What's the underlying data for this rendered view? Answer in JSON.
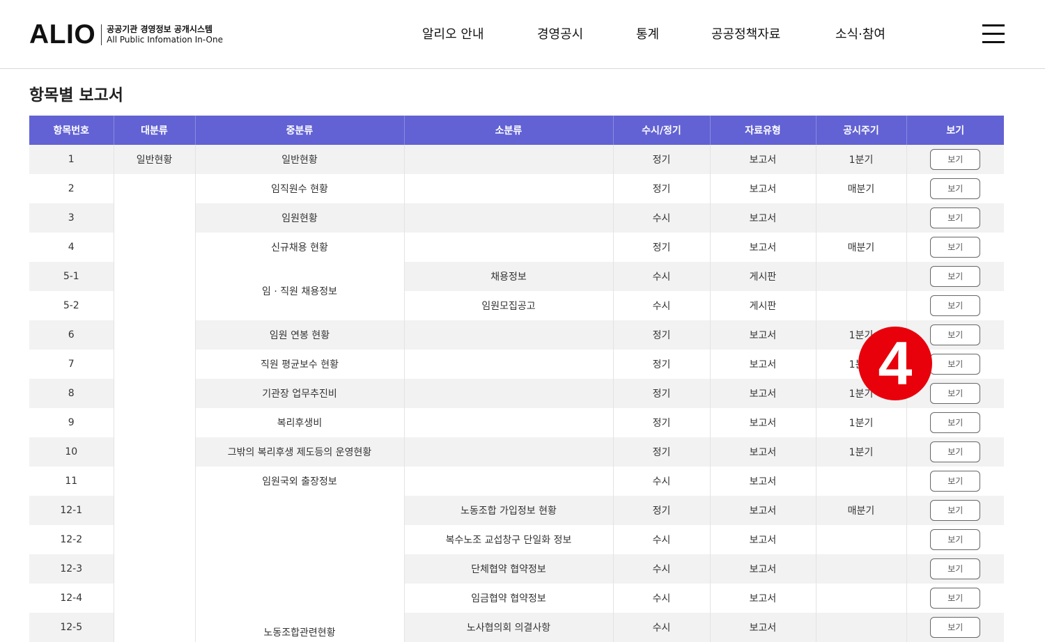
{
  "header": {
    "logo_text": "ALIO",
    "logo_sub_ko": "공공기관 경영정보 공개시스템",
    "logo_sub_en": "All Public Infomation In-One",
    "nav": [
      "알리오 안내",
      "경영공시",
      "통계",
      "공공정책자료",
      "소식·참여"
    ],
    "menu_icon": "hamburger-menu-icon"
  },
  "page": {
    "title": "항목별 보고서"
  },
  "table": {
    "headers": [
      "항목번호",
      "대분류",
      "중분류",
      "소분류",
      "수시/정기",
      "자료유형",
      "공시주기",
      "보기"
    ],
    "view_label": "보기",
    "rows": [
      {
        "no": "1",
        "major": "일반현황",
        "mid": "일반현황",
        "minor": "",
        "type": "정기",
        "data_type": "보고서",
        "cycle": "1분기"
      },
      {
        "no": "2",
        "major": "",
        "mid": "임직원수 현황",
        "minor": "",
        "type": "정기",
        "data_type": "보고서",
        "cycle": "매분기"
      },
      {
        "no": "3",
        "major": "",
        "mid": "임원현황",
        "minor": "",
        "type": "수시",
        "data_type": "보고서",
        "cycle": ""
      },
      {
        "no": "4",
        "major": "",
        "mid": "신규채용 현황",
        "minor": "",
        "type": "정기",
        "data_type": "보고서",
        "cycle": "매분기"
      },
      {
        "no": "5-1",
        "major": "",
        "mid": "임 · 직원 채용정보",
        "minor": "채용정보",
        "type": "수시",
        "data_type": "게시판",
        "cycle": ""
      },
      {
        "no": "5-2",
        "major": "",
        "mid": "",
        "minor": "임원모집공고",
        "type": "수시",
        "data_type": "게시판",
        "cycle": ""
      },
      {
        "no": "6",
        "major": "",
        "mid": "임원 연봉 현황",
        "minor": "",
        "type": "정기",
        "data_type": "보고서",
        "cycle": "1분기"
      },
      {
        "no": "7",
        "major": "",
        "mid": "직원 평균보수 현황",
        "minor": "",
        "type": "정기",
        "data_type": "보고서",
        "cycle": "1분기"
      },
      {
        "no": "8",
        "major": "",
        "mid": "기관장 업무추진비",
        "minor": "",
        "type": "정기",
        "data_type": "보고서",
        "cycle": "1분기"
      },
      {
        "no": "9",
        "major": "",
        "mid": "복리후생비",
        "minor": "",
        "type": "정기",
        "data_type": "보고서",
        "cycle": "1분기"
      },
      {
        "no": "10",
        "major": "",
        "mid": "그밖의 복리후생 제도등의 운영현황",
        "minor": "",
        "type": "정기",
        "data_type": "보고서",
        "cycle": "1분기"
      },
      {
        "no": "11",
        "major": "",
        "mid": "임원국외 출장정보",
        "minor": "",
        "type": "수시",
        "data_type": "보고서",
        "cycle": ""
      },
      {
        "no": "12-1",
        "major": "",
        "mid": "노동조합관련현황",
        "minor": "노동조합 가입정보 현황",
        "type": "정기",
        "data_type": "보고서",
        "cycle": "매분기"
      },
      {
        "no": "12-2",
        "major": "",
        "mid": "",
        "minor": "복수노조 교섭창구 단일화 정보",
        "type": "수시",
        "data_type": "보고서",
        "cycle": ""
      },
      {
        "no": "12-3",
        "major": "",
        "mid": "",
        "minor": "단체협약 협약정보",
        "type": "수시",
        "data_type": "보고서",
        "cycle": ""
      },
      {
        "no": "12-4",
        "major": "",
        "mid": "",
        "minor": "임금협약 협약정보",
        "type": "수시",
        "data_type": "보고서",
        "cycle": ""
      },
      {
        "no": "12-5",
        "major": "",
        "mid": "",
        "minor": "노사협의회 의결사항",
        "type": "수시",
        "data_type": "보고서",
        "cycle": ""
      }
    ]
  },
  "badge": {
    "number": "4",
    "color": "#e8000b"
  },
  "colors": {
    "header_bg": "#6262d4",
    "odd_row": "#f2f2f2",
    "badge": "#e8000b"
  }
}
